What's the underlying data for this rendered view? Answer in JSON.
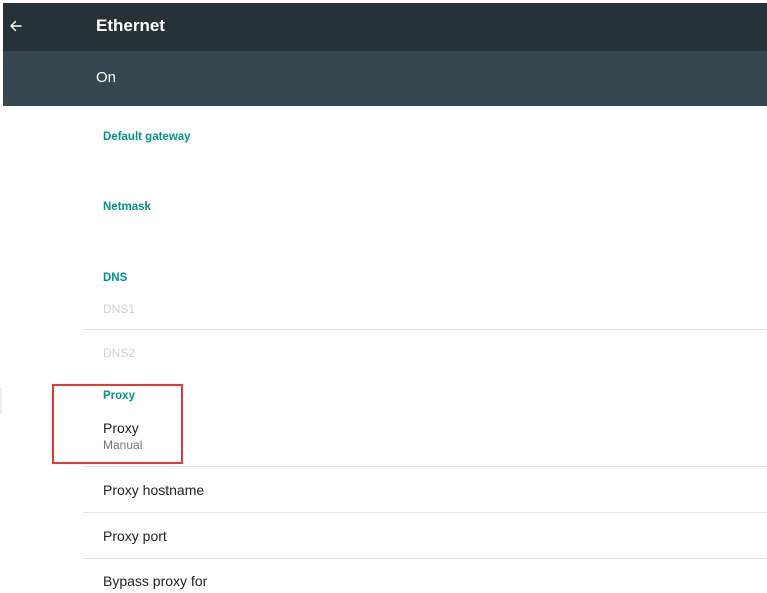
{
  "appbar": {
    "title": "Ethernet",
    "back_icon": "arrow-left-icon"
  },
  "switchbar": {
    "label": "On"
  },
  "sections": {
    "default_gateway": {
      "header": "Default gateway"
    },
    "netmask": {
      "header": "Netmask"
    },
    "dns": {
      "header": "DNS",
      "dns1": "DNS1",
      "dns2": "DNS2"
    },
    "proxy": {
      "header": "Proxy",
      "proxy_title": "Proxy",
      "proxy_summary": "Manual",
      "hostname": "Proxy hostname",
      "port": "Proxy port",
      "bypass": "Bypass proxy for"
    }
  },
  "colors": {
    "appbar": "#263238",
    "switchbar": "#37474f",
    "accent": "#009688",
    "highlight": "#e53935"
  }
}
